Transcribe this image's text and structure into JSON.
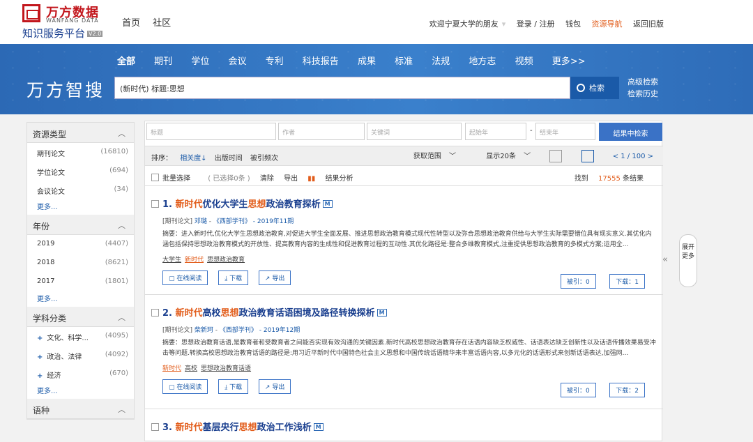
{
  "header": {
    "logo_cn": "万方数据",
    "logo_en": "WANFANG DATA",
    "logo_sub": "知识服务平台",
    "logo_version": "V2.0",
    "nav": [
      "首页",
      "社区"
    ],
    "welcome": "欢迎宁夏大学的朋友",
    "login": "登录 / 注册",
    "wallet": "钱包",
    "resource_nav": "资源导航",
    "old_version": "返回旧版"
  },
  "banner": {
    "brand": "万方智搜",
    "categories": [
      "全部",
      "期刊",
      "学位",
      "会议",
      "专利",
      "科技报告",
      "成果",
      "标准",
      "法规",
      "地方志",
      "视频",
      "更多>>"
    ],
    "search_value": "(新时代) 标题:思想",
    "search_button": "检索",
    "advanced": "高级检索",
    "history": "检索历史"
  },
  "sidebar": {
    "groups": [
      {
        "title": "资源类型",
        "items": [
          {
            "label": "期刊论文",
            "count": "(16810)"
          },
          {
            "label": "学位论文",
            "count": "(694)"
          },
          {
            "label": "会议论文",
            "count": "(34)"
          }
        ],
        "more": "更多..."
      },
      {
        "title": "年份",
        "items": [
          {
            "label": "2019",
            "count": "(4407)"
          },
          {
            "label": "2018",
            "count": "(8621)"
          },
          {
            "label": "2017",
            "count": "(1801)"
          }
        ],
        "more": "更多..."
      },
      {
        "title": "学科分类",
        "items": [
          {
            "label": "文化、科学...",
            "count": "(4095)"
          },
          {
            "label": "政治、法律",
            "count": "(4092)"
          },
          {
            "label": "经济",
            "count": "(670)"
          }
        ],
        "more": "更多..."
      },
      {
        "title": "语种"
      }
    ]
  },
  "filters": {
    "title_ph": "标题",
    "author_ph": "作者",
    "keyword_ph": "关键词",
    "start_year_ph": "起始年",
    "end_year_ph": "结束年",
    "dash": "-",
    "button": "结果中检索"
  },
  "sortbar": {
    "label": "排序：",
    "options": [
      "相关度↓",
      "出版时间",
      "被引频次"
    ],
    "range": "获取范围",
    "display": "显示20条",
    "pager": "< 1 / 100 >"
  },
  "batch": {
    "select": "批量选择",
    "selected": "( 已选择0条 )",
    "clear": "清除",
    "export": "导出",
    "analysis": "结果分析",
    "found_pre": "找到",
    "found_num": "17555",
    "found_post": "条结果"
  },
  "results": [
    {
      "num": "1.",
      "title_hl1": "新时代",
      "title_mid": "优化大学生",
      "title_hl2": "思想",
      "title_end": "政治教育探析",
      "badge": "M",
      "type": "[期刊论文]",
      "author": "邓璐",
      "journal": "《西部学刊》",
      "date": "- 2019年11期",
      "abstract": "摘要：进入新时代,优化大学生思想政治教育,对促进大学生全面发展、推进思想政治教育模式现代性转型以及弥合思想政治教育供给与大学生实际需要错位具有现实意义.其优化内涵包括保持思想政治教育模式的开放性、提高教育内容的生成性和促进教育过程的互动性.其优化路径是:整合多维教育模式,注重提供思想政治教育的多模式方案;运用全...",
      "keywords": [
        "大学生",
        "新时代",
        "思想政治教育"
      ],
      "cite": "被引：0",
      "download": "下载：1"
    },
    {
      "num": "2.",
      "title_hl1": "新时代",
      "title_mid": "高校",
      "title_hl2": "思想",
      "title_end": "政治教育话语困境及路径转换探析",
      "badge": "M",
      "type": "[期刊论文]",
      "author": "柴新珂",
      "journal": "《西部学刊》",
      "date": "- 2019年12期",
      "abstract": "摘要：思想政治教育话语,是教育者和受教育者之间能否实现有效沟通的关键因素.新时代高校思想政治教育存在话语内容缺乏权威性、话语表达缺乏创新性以及话语传播效果易受冲击等问题.转换高校思想政治教育话语的路径是:用习近平新时代中国特色社会主义思想和中国传统话语精华来丰富话语内容,以多元化的话语形式来创新话语表达,加强网...",
      "keywords": [
        "新时代",
        "高校",
        "思想政治教育话语"
      ],
      "cite": "被引：0",
      "download": "下载：2"
    },
    {
      "num": "3.",
      "title_hl1": "新时代",
      "title_mid": "基层央行",
      "title_hl2": "思想",
      "title_end": "政治工作浅析",
      "badge": "M"
    }
  ],
  "buttons": {
    "read": "在线阅读",
    "download": "下载",
    "export": "导出"
  },
  "expand": {
    "label": "展开更多",
    "collapse_icon": "«"
  }
}
